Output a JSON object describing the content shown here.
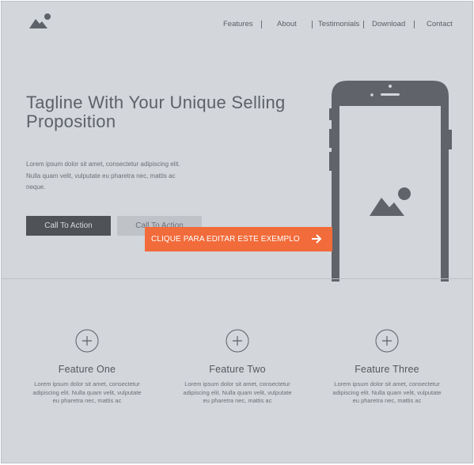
{
  "nav": {
    "items": [
      {
        "label": "Features"
      },
      {
        "label": "About"
      },
      {
        "label": "Testimonials"
      },
      {
        "label": "Download"
      },
      {
        "label": "Contact"
      }
    ]
  },
  "hero": {
    "tagline": "Tagline With Your Unique Selling Proposition",
    "description": "Lorem ipsum dolor sit amet, consectetur adipiscing elit. Nulla quam velit, vulputate eu pharetra nec, mattis ac neque.",
    "primary_cta": "Call To Action",
    "secondary_cta": "Call To Action"
  },
  "edit_banner": {
    "label": "CLIQUE PARA EDITAR ESTE EXEMPLO"
  },
  "features": [
    {
      "title": "Feature One",
      "text": "Lorem ipsum dolor sit amet, consectetur adipiscing elit. Nulla quam velit, vulputate eu pharetra nec, mattis ac"
    },
    {
      "title": "Feature Two",
      "text": "Lorem ipsum dolor sit amet, consectetur adipiscing elit. Nulla quam velit, vulputate eu pharetra nec, mattis ac"
    },
    {
      "title": "Feature Three",
      "text": "Lorem ipsum dolor sit amet, consectetur adipiscing elit. Nulla quam velit, vulputate eu pharetra nec, mattis ac"
    }
  ],
  "icons": {
    "logo": "image-placeholder-icon",
    "phone_screen": "image-placeholder-icon",
    "feature": "plus-circle-icon",
    "banner_arrow": "arrow-right-icon"
  },
  "colors": {
    "background": "#d3d6da",
    "wireframe_dark": "#606369",
    "primary_button": "#4f5257",
    "secondary_button": "#bfc3c8",
    "banner": "#f26b3a"
  }
}
